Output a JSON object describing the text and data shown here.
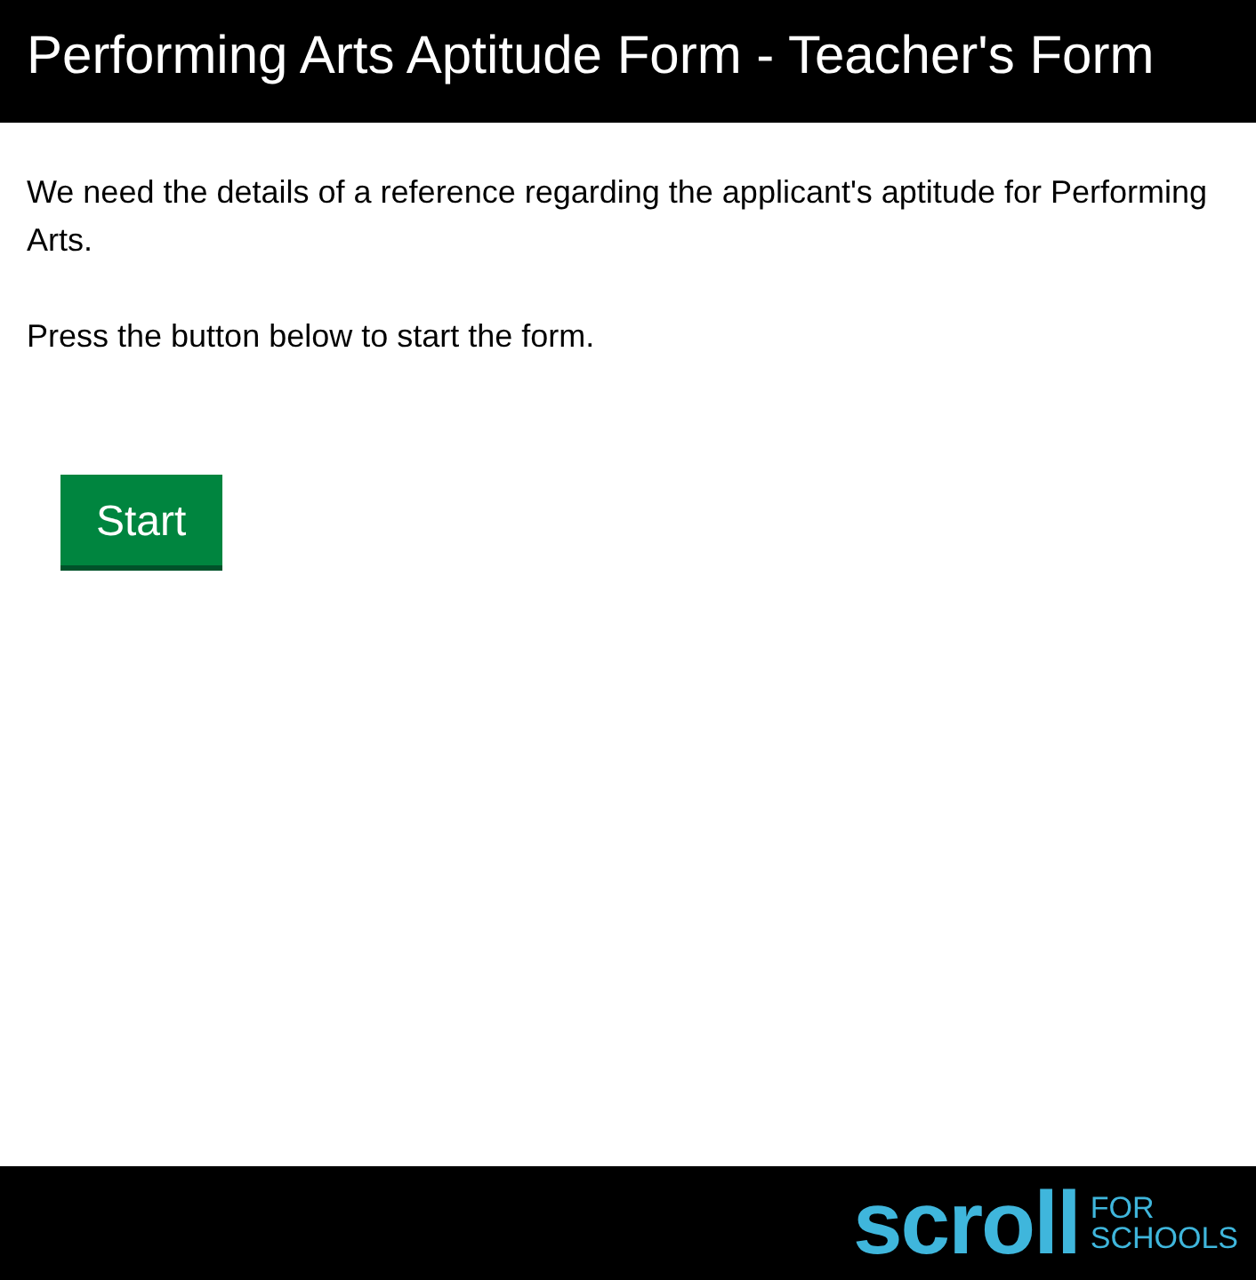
{
  "header": {
    "title": "Performing Arts Aptitude Form - Teacher's Form"
  },
  "paragraphs": [
    "We need the details of a reference regarding the applicant's aptitude for Performing Arts.",
    "Press the button below to start the form."
  ],
  "start_button": {
    "label": "Start"
  },
  "footer": {
    "logo_word": "scroll",
    "logo_lines": [
      "FOR",
      "SCHOOLS"
    ]
  }
}
